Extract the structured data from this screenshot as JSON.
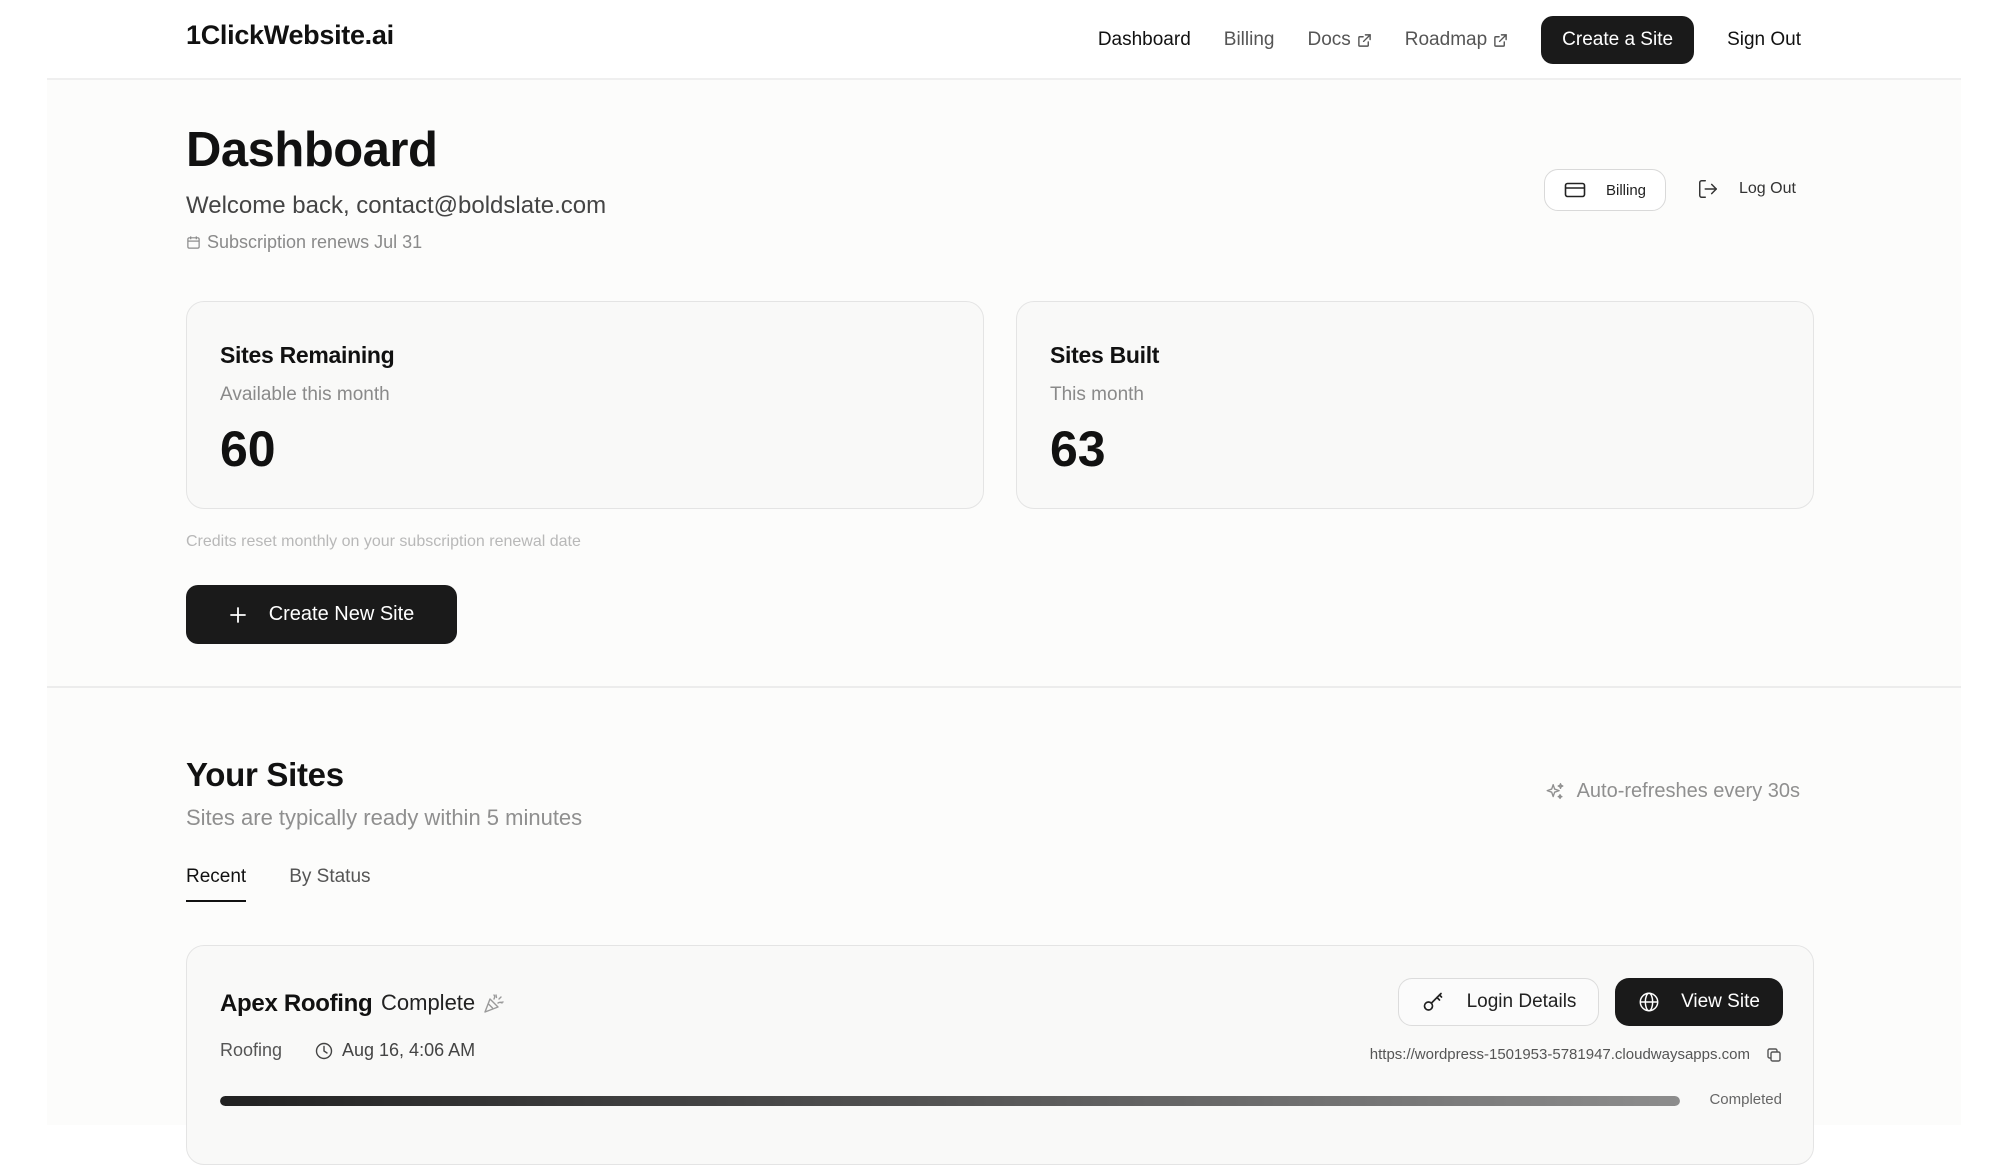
{
  "header": {
    "logo": "1ClickWebsite.ai",
    "nav": {
      "dashboard": "Dashboard",
      "billing": "Billing",
      "docs": "Docs",
      "roadmap": "Roadmap"
    },
    "create_site": "Create a Site",
    "sign_out": "Sign Out"
  },
  "dashboard": {
    "title": "Dashboard",
    "welcome": "Welcome back, contact@boldslate.com",
    "subscription": "Subscription renews Jul 31",
    "billing_button": "Billing",
    "logout_button": "Log Out"
  },
  "stats": {
    "remaining": {
      "title": "Sites Remaining",
      "subtitle": "Available this month",
      "value": "60"
    },
    "built": {
      "title": "Sites Built",
      "subtitle": "This month",
      "value": "63"
    }
  },
  "credits_note": "Credits reset monthly on your subscription renewal date",
  "create_new_site": "Create New Site",
  "sites": {
    "title": "Your Sites",
    "subtitle": "Sites are typically ready within 5 minutes",
    "auto_refresh": "Auto-refreshes every 30s",
    "tabs": [
      {
        "label": "Recent",
        "active": true
      },
      {
        "label": "By Status",
        "active": false
      }
    ],
    "items": [
      {
        "name": "Apex Roofing",
        "status": "Complete",
        "category": "Roofing",
        "time": "Aug 16, 4:06 AM",
        "url": "https://wordpress-1501953-5781947.cloudwaysapps.com",
        "login_label": "Login Details",
        "view_label": "View Site",
        "progress": 1.0,
        "progress_label": "Completed"
      }
    ]
  },
  "colors": {
    "primary_dark": "#1a1a1a",
    "muted_text": "#8a8a8a",
    "card_bg": "#f9f9f8",
    "border": "#e4e4e4"
  }
}
